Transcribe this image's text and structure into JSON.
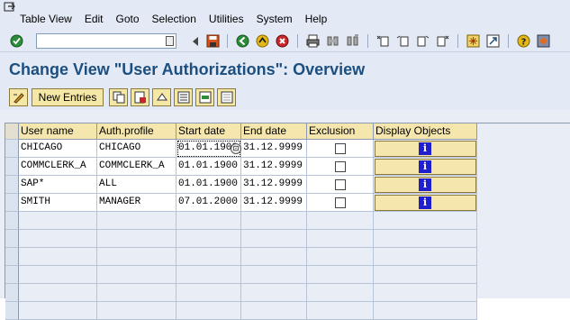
{
  "menu": [
    "Table View",
    "Edit",
    "Goto",
    "Selection",
    "Utilities",
    "System",
    "Help"
  ],
  "command_field": {
    "value": ""
  },
  "title": "Change View \"User Authorizations\": Overview",
  "app_toolbar": {
    "new_entries_label": "New Entries"
  },
  "table": {
    "columns": [
      "User name",
      "Auth.profile",
      "Start date",
      "End date",
      "Exclusion",
      "Display Objects"
    ],
    "rows": [
      {
        "user": "CHICAGO",
        "profile": "CHICAGO",
        "start": "01.01.1900",
        "end": "31.12.9999",
        "exclusion": false
      },
      {
        "user": "COMMCLERK_A",
        "profile": "COMMCLERK_A",
        "start": "01.01.1900",
        "end": "31.12.9999",
        "exclusion": false
      },
      {
        "user": "SAP*",
        "profile": "ALL",
        "start": "01.01.1900",
        "end": "31.12.9999",
        "exclusion": false
      },
      {
        "user": "SMITH",
        "profile": "MANAGER",
        "start": "07.01.2000",
        "end": "31.12.9999",
        "exclusion": false
      }
    ],
    "empty_rows": 8
  },
  "colors": {
    "menubar_bg": "#e3eaf5",
    "title": "#1c4f80",
    "header_bg": "#f4e6ad",
    "info_icon": "#1f1fd0"
  }
}
